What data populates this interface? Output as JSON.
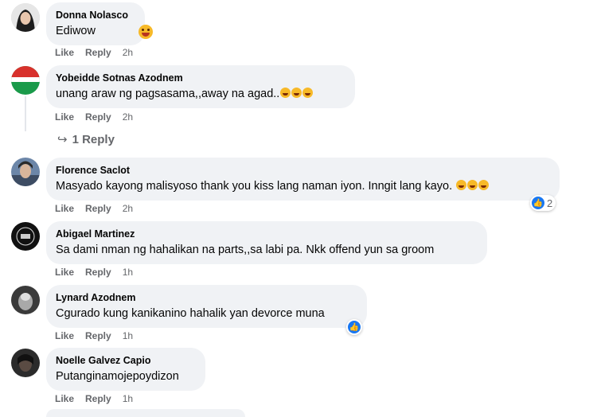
{
  "comments": [
    {
      "author": "Donna Nolasco",
      "text": "Ediwow",
      "like": "Like",
      "reply": "Reply",
      "time": "2h"
    },
    {
      "author": "Yobeidde Sotnas Azodnem",
      "text": "unang araw ng pagsasama,,away na agad..",
      "like": "Like",
      "reply": "Reply",
      "time": "2h",
      "replies_label": "1 Reply"
    },
    {
      "author": "Florence Saclot",
      "text": "Masyado kayong malisyoso thank you kiss lang naman iyon. Inngit lang kayo.",
      "like": "Like",
      "reply": "Reply",
      "time": "2h",
      "reaction_count": "2"
    },
    {
      "author": "Abigael Martinez",
      "text": "Sa dami nman ng hahalikan na parts,,sa labi pa. Nkk offend yun sa groom",
      "like": "Like",
      "reply": "Reply",
      "time": "1h"
    },
    {
      "author": "Lynard Azodnem",
      "text": "Cgurado kung kanikanino hahalik yan devorce muna",
      "like": "Like",
      "reply": "Reply",
      "time": "1h"
    },
    {
      "author": "Noelle Galvez Capio",
      "text": "Putanginamojepoydizon",
      "like": "Like",
      "reply": "Reply",
      "time": "1h"
    }
  ],
  "colors": {
    "bubble": "#f0f2f5",
    "meta": "#65676b",
    "like_blue": "#1877f2"
  },
  "icons": {
    "reaction": "like-icon",
    "reply_arrow": "reply-arrow-icon"
  }
}
